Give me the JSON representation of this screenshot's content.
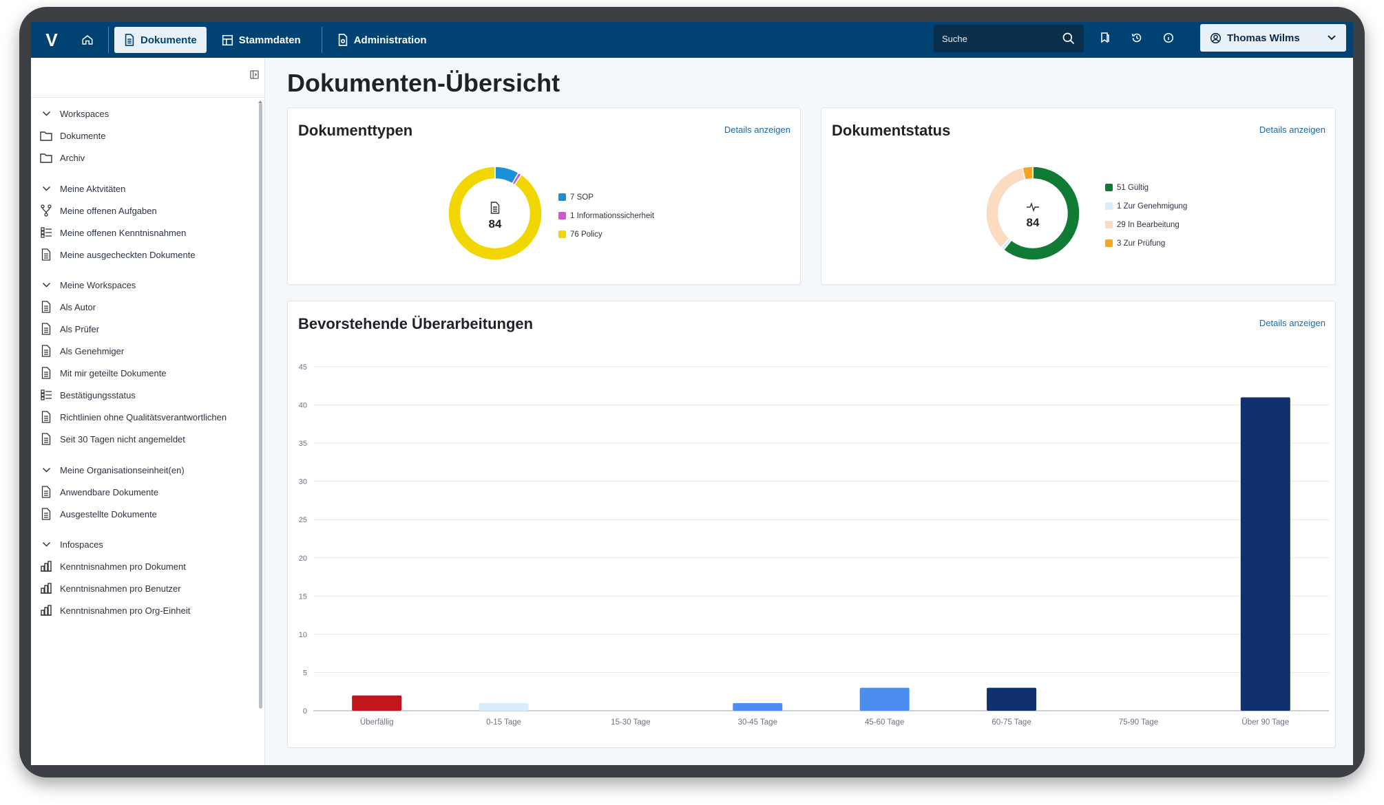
{
  "topbar": {
    "logo": "V",
    "tabs": [
      {
        "label": "Dokumente",
        "active": true
      },
      {
        "label": "Stammdaten",
        "active": false
      },
      {
        "label": "Administration",
        "active": false
      }
    ],
    "search_placeholder": "Suche",
    "user_name": "Thomas Wilms",
    "brand_color": "#004372"
  },
  "sidebar": {
    "sections": [
      {
        "title": "Workspaces",
        "items": [
          {
            "label": "Dokumente",
            "icon": "folder-icon"
          },
          {
            "label": "Archiv",
            "icon": "folder-icon"
          }
        ]
      },
      {
        "title": "Meine Aktvitäten",
        "items": [
          {
            "label": "Meine offenen Aufgaben",
            "icon": "workflow-icon"
          },
          {
            "label": "Meine offenen Kenntnisnahmen",
            "icon": "checklist-icon"
          },
          {
            "label": "Meine ausgecheckten Dokumente",
            "icon": "document-icon"
          }
        ]
      },
      {
        "title": "Meine Workspaces",
        "items": [
          {
            "label": "Als Autor",
            "icon": "document-icon"
          },
          {
            "label": "Als Prüfer",
            "icon": "document-icon"
          },
          {
            "label": "Als Genehmiger",
            "icon": "document-icon"
          },
          {
            "label": "Mit mir geteilte Dokumente",
            "icon": "document-icon"
          },
          {
            "label": "Bestätigungsstatus",
            "icon": "checklist-icon"
          },
          {
            "label": "Richtlinien ohne Qualitätsverantwortlichen",
            "icon": "document-icon"
          },
          {
            "label": "Seit 30 Tagen nicht angemeldet",
            "icon": "document-icon"
          }
        ]
      },
      {
        "title": "Meine Organisationseinheit(en)",
        "items": [
          {
            "label": "Anwendbare Dokumente",
            "icon": "document-icon"
          },
          {
            "label": "Ausgestellte Dokumente",
            "icon": "document-icon"
          }
        ]
      },
      {
        "title": "Infospaces",
        "items": [
          {
            "label": "Kenntnisnahmen pro Dokument",
            "icon": "bar-chart-icon"
          },
          {
            "label": "Kenntnisnahmen pro Benutzer",
            "icon": "bar-chart-icon"
          },
          {
            "label": "Kenntnisnahmen pro Org-Einheit",
            "icon": "bar-chart-icon"
          }
        ]
      }
    ]
  },
  "main": {
    "page_title": "Dokumenten-Übersicht",
    "types_card": {
      "title": "Dokumenttypen",
      "link": "Details anzeigen",
      "total": "84",
      "legend": [
        "7 SOP",
        "1 Informationssicherheit",
        "76 Policy"
      ]
    },
    "status_card": {
      "title": "Dokumentstatus",
      "link": "Details anzeigen",
      "total": "84",
      "legend": [
        "51 Gültig",
        "1 Zur Genehmigung",
        "29 In Bearbeitung",
        "3 Zur Prüfung"
      ]
    },
    "revisions_card": {
      "title": "Bevorstehende Überarbeitungen",
      "link": "Details anzeigen"
    }
  },
  "chart_data": [
    {
      "type": "pie",
      "title": "Dokumenttypen",
      "categories": [
        "SOP",
        "Informationssicherheit",
        "Policy"
      ],
      "values": [
        7,
        1,
        76
      ],
      "colors": [
        "#1a91d6",
        "#c95bc8",
        "#f2d600"
      ]
    },
    {
      "type": "pie",
      "title": "Dokumentstatus",
      "categories": [
        "Gültig",
        "Zur Genehmigung",
        "In Bearbeitung",
        "Zur Prüfung"
      ],
      "values": [
        51,
        1,
        29,
        3
      ],
      "colors": [
        "#0f7b34",
        "#d8ecfb",
        "#fbdcc0",
        "#f4a623"
      ]
    },
    {
      "type": "bar",
      "title": "Bevorstehende Überarbeitungen",
      "categories": [
        "Überfällig",
        "0-15 Tage",
        "15-30 Tage",
        "30-45 Tage",
        "45-60 Tage",
        "60-75 Tage",
        "75-90 Tage",
        "Über 90 Tage"
      ],
      "values": [
        2,
        1,
        0,
        1,
        3,
        3,
        0,
        41
      ],
      "colors": [
        "#c0161c",
        "#d8ecfb",
        "#4c8df0",
        "#4c8df0",
        "#4c8df0",
        "#11306f",
        "#11306f",
        "#11306f"
      ],
      "ylim": [
        0,
        45
      ],
      "yticks": [
        0,
        5,
        10,
        15,
        20,
        25,
        30,
        35,
        40,
        45
      ],
      "grid": true
    }
  ]
}
